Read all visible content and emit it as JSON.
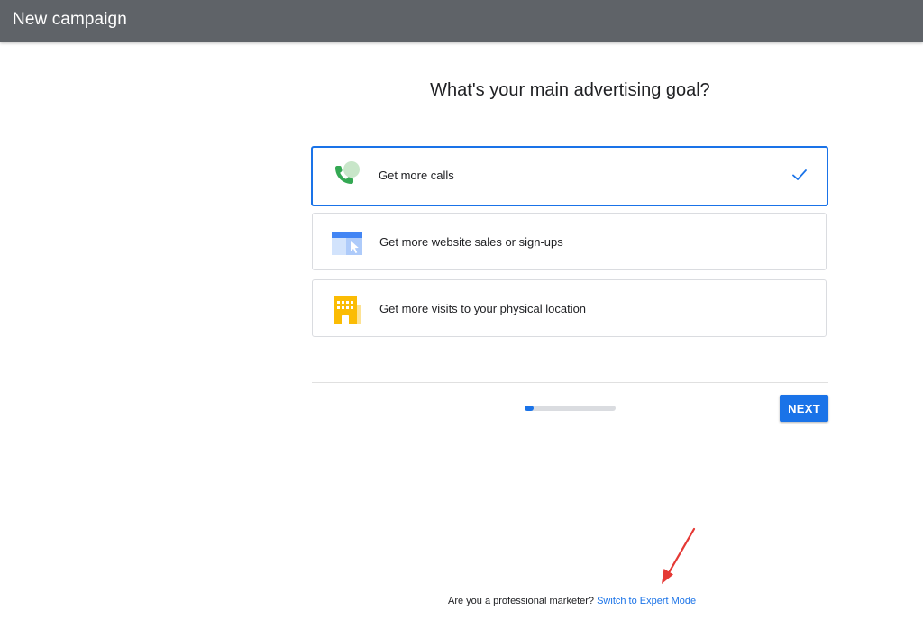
{
  "header": {
    "title": "New campaign",
    "background_color": "#5f6368"
  },
  "main": {
    "question": "What's your main advertising goal?",
    "goals": [
      {
        "label": "Get more calls",
        "icon": "phone-call-icon",
        "selected": true
      },
      {
        "label": "Get more website sales or sign-ups",
        "icon": "website-cursor-icon",
        "selected": false
      },
      {
        "label": "Get more visits to your physical location",
        "icon": "storefront-building-icon",
        "selected": false
      }
    ],
    "selected_icon": "checkmark-icon",
    "accent_color": "#1a73e8"
  },
  "progress": {
    "fraction": 0.1
  },
  "actions": {
    "next_label": "NEXT"
  },
  "footer": {
    "prompt": "Are you a professional marketer?",
    "link_label": "Switch to Expert Mode"
  },
  "annotation": {
    "arrow_color": "#e53935",
    "arrow_icon": "red-arrow-annotation"
  }
}
